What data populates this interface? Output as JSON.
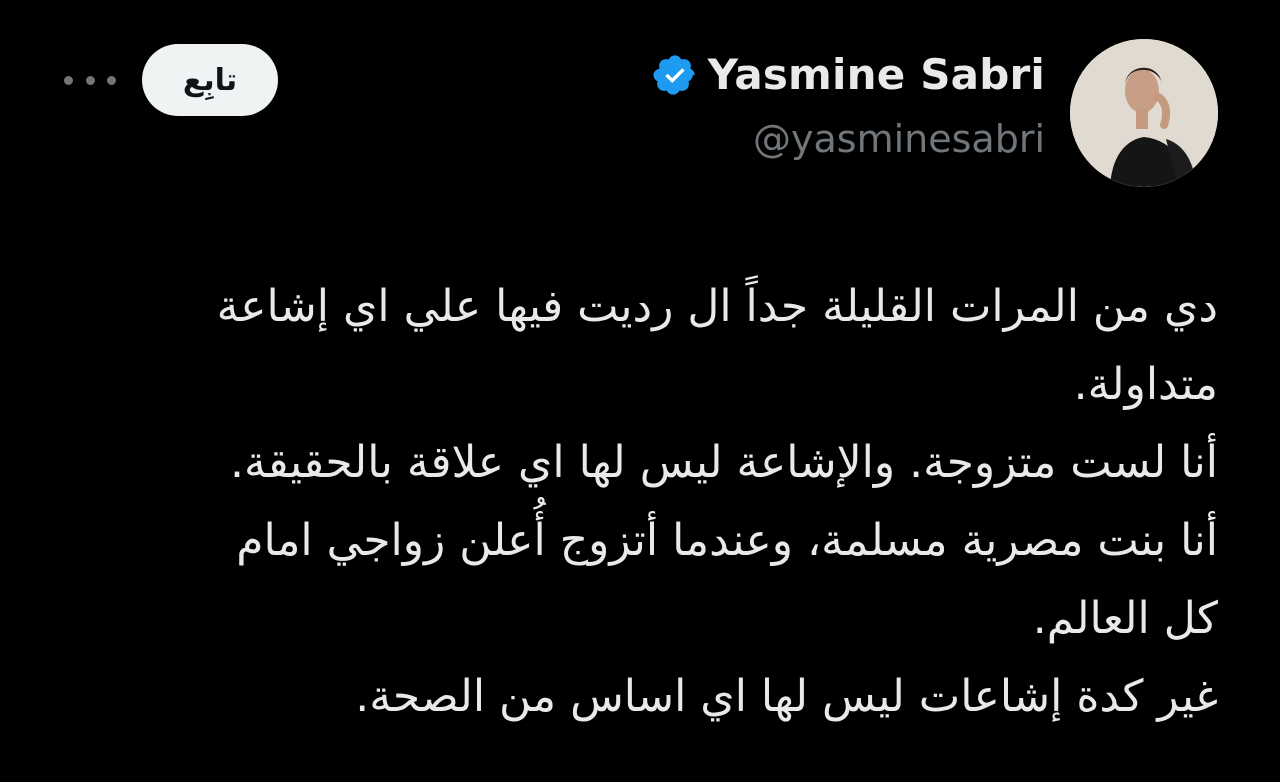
{
  "author": {
    "display_name": "Yasmine Sabri",
    "handle": "@yasminesabri",
    "verified": true,
    "verified_color": "#1d9bf0"
  },
  "actions": {
    "follow_label": "تابِع",
    "more_icon": "more-horizontal-icon"
  },
  "tweet": {
    "lines": [
      "دي من المرات القليلة جداً ال رديت فيها علي اي إشاعة",
      "متداولة.",
      "أنا لست متزوجة. والإشاعة ليس لها اي علاقة بالحقيقة.",
      "أنا بنت مصرية مسلمة، وعندما أتزوج أُعلن زواجي امام",
      "كل العالم.",
      "غير كدة إشاعات ليس لها اي اساس من الصحة."
    ]
  },
  "colors": {
    "background": "#000000",
    "primary_text": "#e7e9ea",
    "secondary_text": "#71767b",
    "follow_bg": "#eff3f4"
  }
}
